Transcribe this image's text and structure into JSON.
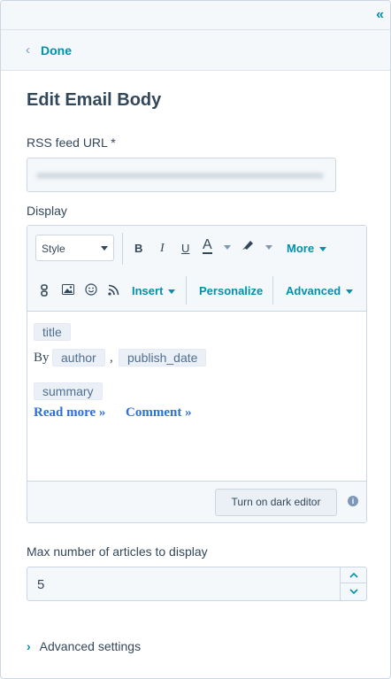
{
  "topbar": {
    "collapse_icon": "double-chevron-left-icon",
    "collapse_glyph": "«"
  },
  "done": {
    "chevron_glyph": "‹",
    "label": "Done"
  },
  "panel": {
    "title": "Edit Email Body"
  },
  "rss": {
    "label": "RSS feed URL *",
    "value": ""
  },
  "display": {
    "label": "Display",
    "toolbar": {
      "style_select": "Style",
      "bold": "B",
      "italic": "I",
      "underline": "U",
      "font_color": "A",
      "more": "More",
      "insert": "Insert",
      "personalize": "Personalize",
      "advanced": "Advanced"
    },
    "body": {
      "token_title": "title",
      "by_text": "By",
      "token_author": "author",
      "comma": ",",
      "token_publish_date": "publish_date",
      "token_summary": "summary",
      "read_more": "Read more »",
      "comment": "Comment »"
    },
    "footer": {
      "dark_editor_button": "Turn on dark editor",
      "info_glyph": "i"
    }
  },
  "max_articles": {
    "label": "Max number of articles to display",
    "value": "5",
    "up_glyph": "▲",
    "down_glyph": "▼"
  },
  "advanced_settings": {
    "chevron_glyph": "›",
    "label": "Advanced settings"
  },
  "colors": {
    "accent": "#0091ae",
    "text": "#33475b",
    "link": "#2e6ed8",
    "token_bg": "#eaf0f6"
  }
}
